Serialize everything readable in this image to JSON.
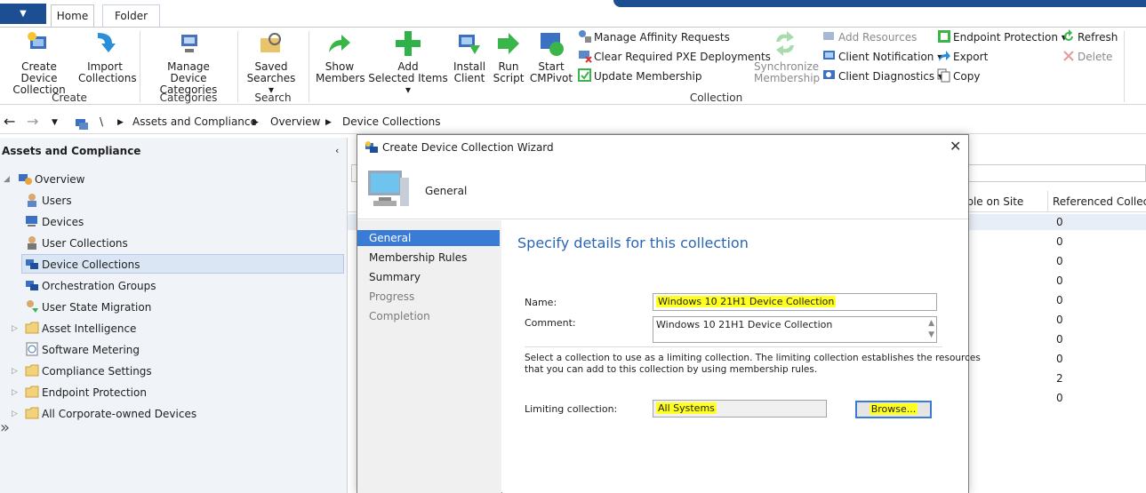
{
  "tabs": {
    "home": "Home",
    "folder": "Folder"
  },
  "ribbon": {
    "create": {
      "create_device_collection": [
        "Create Device",
        "Collection"
      ],
      "import_collections": [
        "Import",
        "Collections"
      ],
      "group": "Create"
    },
    "categories": {
      "manage_device_categories": [
        "Manage Device",
        "Categories"
      ],
      "group": "Categories"
    },
    "search": {
      "saved_searches": [
        "Saved",
        "Searches ▾"
      ],
      "group": "Search"
    },
    "collection": {
      "show_members": [
        "Show",
        "Members"
      ],
      "add_selected_items": [
        "Add",
        "Selected Items ▾"
      ],
      "install_client": [
        "Install",
        "Client"
      ],
      "run_script": [
        "Run",
        "Script"
      ],
      "start_cmpivot": [
        "Start",
        "CMPivot"
      ],
      "manage_affinity_requests": "Manage Affinity Requests",
      "clear_pxe": "Clear Required PXE Deployments",
      "update_membership": "Update Membership",
      "synchronize_membership": [
        "Synchronize",
        "Membership"
      ],
      "add_resources": "Add Resources",
      "client_notification": "Client Notification ▾",
      "client_diagnostics": "Client Diagnostics ▾",
      "endpoint_protection": "Endpoint Protection ▾",
      "export": "Export",
      "copy": "Copy",
      "refresh": "Refresh",
      "delete": "Delete",
      "group": "Collection"
    }
  },
  "address": {
    "root": "\\",
    "crumb1": "Assets and Compliance",
    "crumb2": "Overview",
    "crumb3": "Device Collections"
  },
  "nav": {
    "title": "Assets and Compliance",
    "overview": "Overview",
    "items": [
      "Users",
      "Devices",
      "User Collections",
      "Device Collections",
      "Orchestration Groups",
      "User State Migration",
      "Asset Intelligence",
      "Software Metering",
      "Compliance Settings",
      "Endpoint Protection",
      "All Corporate-owned Devices"
    ]
  },
  "list": {
    "col_visible": "ible on Site",
    "col_referenced": "Referenced Collectio",
    "ref_values": [
      "0",
      "0",
      "0",
      "0",
      "0",
      "0",
      "0",
      "0",
      "2",
      "0"
    ]
  },
  "dialog": {
    "title": "Create Device Collection Wizard",
    "header": "General",
    "steps": [
      "General",
      "Membership Rules",
      "Summary",
      "Progress",
      "Completion"
    ],
    "content_title": "Specify details for this collection",
    "name_label": "Name:",
    "name_value": "Windows 10 21H1 Device Collection",
    "comment_label": "Comment:",
    "comment_value": "Windows 10 21H1 Device Collection",
    "limit_desc_1": "Select a collection to use as a limiting collection. The limiting collection establishes the resources",
    "limit_desc_2": "that you can add to this collection by using membership rules.",
    "limiting_label": "Limiting collection:",
    "limiting_value": "All Systems",
    "browse": "Browse..."
  },
  "colors": {
    "accent": "#3a7bd5",
    "highlight": "#ffff20",
    "title_blue": "#2b66b5"
  }
}
